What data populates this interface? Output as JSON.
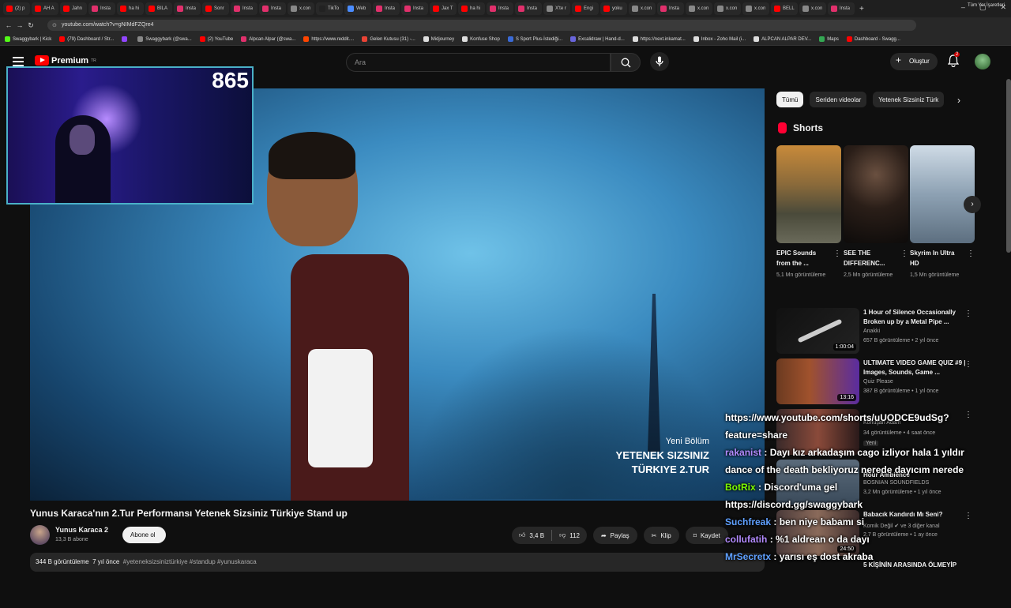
{
  "browser": {
    "tabs": [
      {
        "label": "(2) p",
        "color": "#ff0000"
      },
      {
        "label": "AH A",
        "color": "#ff0000"
      },
      {
        "label": "Jahn",
        "color": "#ff0000"
      },
      {
        "label": "Insta",
        "color": "#e1306c"
      },
      {
        "label": "ha hi",
        "color": "#ff0000"
      },
      {
        "label": "BILA",
        "color": "#ff0000"
      },
      {
        "label": "Insta",
        "color": "#e1306c"
      },
      {
        "label": "Sonr",
        "color": "#ff0000"
      },
      {
        "label": "Insta",
        "color": "#e1306c"
      },
      {
        "label": "Insta",
        "color": "#e1306c"
      },
      {
        "label": "x.con",
        "color": "#888888"
      },
      {
        "label": "TikTo",
        "color": "#222222"
      },
      {
        "label": "Web",
        "color": "#4a8cff"
      },
      {
        "label": "Insta",
        "color": "#e1306c"
      },
      {
        "label": "Insta",
        "color": "#e1306c"
      },
      {
        "label": "Jax T",
        "color": "#ff0000"
      },
      {
        "label": "ha hi",
        "color": "#ff0000"
      },
      {
        "label": "Insta",
        "color": "#e1306c"
      },
      {
        "label": "Insta",
        "color": "#e1306c"
      },
      {
        "label": "X'te r",
        "color": "#888888"
      },
      {
        "label": "Engi",
        "color": "#ff0000"
      },
      {
        "label": "yoku",
        "color": "#ff0000"
      },
      {
        "label": "x.con",
        "color": "#888888"
      },
      {
        "label": "Insta",
        "color": "#e1306c"
      },
      {
        "label": "x.con",
        "color": "#888888"
      },
      {
        "label": "x.con",
        "color": "#888888"
      },
      {
        "label": "x.con",
        "color": "#888888"
      },
      {
        "label": "BELL",
        "color": "#ff0000"
      },
      {
        "label": "x.con",
        "color": "#888888"
      },
      {
        "label": "Insta",
        "color": "#e1306c"
      }
    ],
    "url": "youtube.com/watch?v=gNIMdFZQre4",
    "bookmarks": [
      {
        "label": "Swaggybark | Kick",
        "color": "#53fc18"
      },
      {
        "label": "(79) Dashboard / Str...",
        "color": "#ff0000"
      },
      {
        "label": "",
        "color": "#9146ff"
      },
      {
        "label": "Swaggybark (@swa...",
        "color": "#888888"
      },
      {
        "label": "(2) YouTube",
        "color": "#ff0000"
      },
      {
        "label": "Alpcan Alpar (@swa...",
        "color": "#e1306c"
      },
      {
        "label": "https://www.reddit....",
        "color": "#ff4500"
      },
      {
        "label": "Gelen Kutusu (31) -...",
        "color": "#ea4335"
      },
      {
        "label": "Midjourney",
        "color": "#dddddd"
      },
      {
        "label": "Konfuse Shop",
        "color": "#dddddd"
      },
      {
        "label": "S Sport Plus-İstediği...",
        "color": "#3a6ad6"
      },
      {
        "label": "Excalidraw | Hand-d...",
        "color": "#6965db"
      },
      {
        "label": "https://next.inkamat...",
        "color": "#dddddd"
      },
      {
        "label": "Inbox - Zoho Mail (i...",
        "color": "#dddddd"
      },
      {
        "label": "ALPCAN ALPAR DEV...",
        "color": "#dddddd"
      },
      {
        "label": "Maps",
        "color": "#34a853"
      },
      {
        "label": "Dashboard - Swagg...",
        "color": "#ff0000"
      }
    ],
    "all_bookmarks": "Tüm Yer İşaretleri"
  },
  "header": {
    "logo": "Premium",
    "region": "TR",
    "search_placeholder": "Ara",
    "create_label": "Oluştur",
    "notif_count": "2"
  },
  "webcam": {
    "counter": "865"
  },
  "video": {
    "caption_line1": "Yeni Bölüm",
    "caption_line2": "YETENEK SIZSINIZ",
    "caption_line3": "TÜRKIYE  2.TUR",
    "title": "Yunus Karaca'nın 2.Tur Performansı Yetenek Sizsiniz Türkiye Stand up",
    "channel": "Yunus Karaca 2",
    "subs": "13,3 B abone",
    "subscribe": "Abone ol",
    "likes": "3,4 B",
    "dislikes": "112",
    "share": "Paylaş",
    "clip": "Klip",
    "save": "Kaydet",
    "views": "344 B görüntüleme",
    "age": "7 yıl önce",
    "tags": "#yeteneksizsiniztürkiye #standup #yunuskaraca"
  },
  "chips": [
    "Tümü",
    "Seriden videolar",
    "Yetenek Sizsiniz Türk"
  ],
  "shorts": {
    "title": "Shorts",
    "items": [
      {
        "title": "EPIC Sounds from the ...",
        "views": "5,1 Mn görüntüleme"
      },
      {
        "title": "SEE THE DIFFERENC...",
        "views": "2,5 Mn görüntüleme"
      },
      {
        "title": "Skyrim In Ultra HD",
        "views": "1,5 Mn görüntüleme"
      }
    ]
  },
  "recommended": [
    {
      "title": "1 Hour of Silence Occasionally Broken up by a Metal Pipe ...",
      "channel": "Anakki",
      "meta": "657 B görüntüleme • 2 yıl önce",
      "duration": "1:00:04"
    },
    {
      "title": "ULTIMATE VIDEO GAME QUIZ #9 | Images, Sounds, Game ...",
      "channel": "Quiz Please",
      "meta": "387 B görüntüleme • 1 yıl önce",
      "duration": "13:16"
    },
    {
      "title": "",
      "channel": "Konuşan Adam",
      "meta": "34 görüntüleme • 4 saat önce",
      "duration": ""
    },
    {
      "title": "Hour Ambience",
      "channel": "BOSNIAN SOUNDFIELDS",
      "meta": "3,2 Mn görüntüleme • 1 yıl önce",
      "duration": ""
    },
    {
      "title": "Babacık Kandırdı Mı Seni?",
      "channel": "Komik Değil ✔ ve 3 diğer kanal",
      "meta": "2,7 B görüntüleme • 1 ay önce",
      "duration": "24:50"
    },
    {
      "title": "5 KİŞİNİN ARASINDA ÖLMEYİP",
      "channel": "",
      "meta": "",
      "duration": ""
    }
  ],
  "chat": [
    {
      "user": "",
      "text": "https://www.youtube.com/shorts/uUODCE9udSg?",
      "color": "#ffffff"
    },
    {
      "user": "",
      "text": "feature=share",
      "color": "#ffffff"
    },
    {
      "user": "rakanist",
      "text": ": Dayı kız arkadaşım cago izliyor hala 1 yıldır",
      "color": "#b38bff"
    },
    {
      "user": "",
      "text": "dance of the death bekliyoruz nerede dayıcım nerede",
      "color": "#ffffff"
    },
    {
      "user": "BotRix",
      "text": ": Discord'uma gel",
      "color": "#7cfc00"
    },
    {
      "user": "",
      "text": "https://discord.gg/swaggybark",
      "color": "#ffffff"
    },
    {
      "user": "Suchfreak",
      "text": ": ben niye babamı si",
      "color": "#5fa0ff"
    },
    {
      "user": "collufatih",
      "text": ": %1 aldrean o da dayı",
      "color": "#b38bff"
    },
    {
      "user": "MrSecretx",
      "text": ": yarısı eş dost akraba",
      "color": "#5fa0ff"
    }
  ],
  "chat_extra": "Yeni"
}
